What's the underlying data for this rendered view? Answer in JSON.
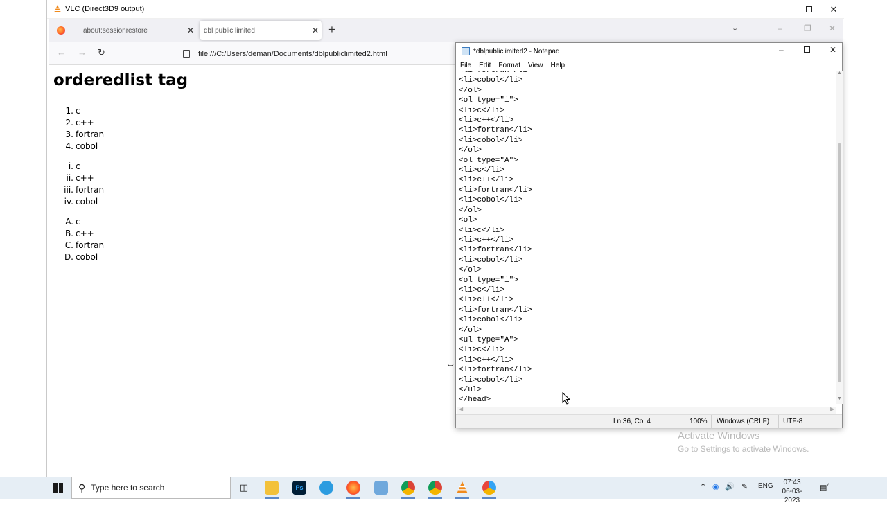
{
  "vlc_window": {
    "title": "VLC (Direct3D9 output)"
  },
  "browser": {
    "tabs": [
      {
        "label": "about:sessionrestore",
        "active": false
      },
      {
        "label": "dbl public limited",
        "active": true
      }
    ],
    "url": "file:///C:/Users/deman/Documents/dblpubliclimited2.html"
  },
  "page": {
    "heading": "orderedlist tag",
    "lists": [
      {
        "items": [
          {
            "marker": "1.",
            "text": "c"
          },
          {
            "marker": "2.",
            "text": "c++"
          },
          {
            "marker": "3.",
            "text": "fortran"
          },
          {
            "marker": "4.",
            "text": "cobol"
          }
        ]
      },
      {
        "items": [
          {
            "marker": "i.",
            "text": "c"
          },
          {
            "marker": "ii.",
            "text": "c++"
          },
          {
            "marker": "iii.",
            "text": "fortran"
          },
          {
            "marker": "iv.",
            "text": "cobol"
          }
        ]
      },
      {
        "items": [
          {
            "marker": "A.",
            "text": "c"
          },
          {
            "marker": "B.",
            "text": "c++"
          },
          {
            "marker": "C.",
            "text": "fortran"
          },
          {
            "marker": "D.",
            "text": "cobol"
          }
        ]
      }
    ]
  },
  "notepad": {
    "title": "*dblpubliclimited2 - Notepad",
    "menu": [
      "File",
      "Edit",
      "Format",
      "View",
      "Help"
    ],
    "lines": [
      "<li>fortran</li>",
      "<li>cobol</li>",
      "</ol>",
      "<ol type=\"i\">",
      "<li>c</li>",
      "<li>c++</li>",
      "<li>fortran</li>",
      "<li>cobol</li>",
      "</ol>",
      "<ol type=\"A\">",
      "<li>c</li>",
      "<li>c++</li>",
      "<li>fortran</li>",
      "<li>cobol</li>",
      "</ol>",
      "<ol>",
      "<li>c</li>",
      "<li>c++</li>",
      "<li>fortran</li>",
      "<li>cobol</li>",
      "</ol>",
      "<ol type=\"i\">",
      "<li>c</li>",
      "<li>c++</li>",
      "<li>fortran</li>",
      "<li>cobol</li>",
      "</ol>",
      "<ul type=\"A\">",
      "<li>c</li>",
      "<li>c++</li>",
      "<li>fortran</li>",
      "<li>cobol</li>",
      "</ul>",
      "</head>"
    ],
    "status": {
      "position": "Ln 36, Col 4",
      "zoom": "100%",
      "line_ending": "Windows (CRLF)",
      "encoding": "UTF-8"
    }
  },
  "watermark": {
    "line1": "Activate Windows",
    "line2": "Go to Settings to activate Windows."
  },
  "taskbar": {
    "search_placeholder": "Type here to search",
    "language": "ENG",
    "time": "07:43",
    "date": "06-03-2023",
    "notification_count": "4"
  },
  "colors": {
    "vlc_orange": "#f08a1c",
    "taskbar": "#e6eef5",
    "tab_strip": "#f0f0f4"
  }
}
